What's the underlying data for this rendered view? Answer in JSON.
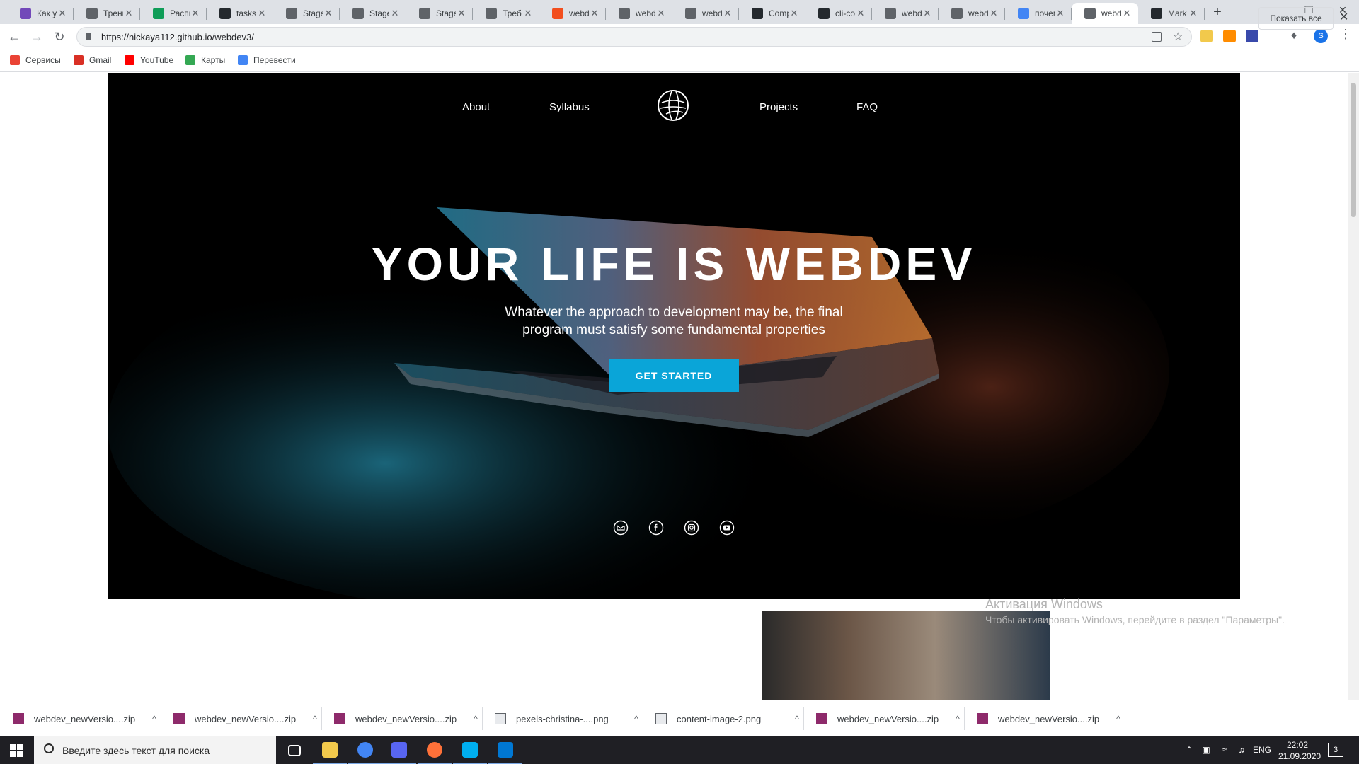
{
  "browser": {
    "tabs": [
      {
        "title": "Как у",
        "icon": "form-icon",
        "color": "#7248b9"
      },
      {
        "title": "Трени",
        "icon": "cap-icon",
        "color": "#5f6368"
      },
      {
        "title": "Распи",
        "icon": "sheets-icon",
        "color": "#0f9d58"
      },
      {
        "title": "tasks/",
        "icon": "github-icon",
        "color": "#24292e"
      },
      {
        "title": "Stage",
        "icon": "globe-icon",
        "color": "#5f6368"
      },
      {
        "title": "Stage",
        "icon": "globe-icon",
        "color": "#5f6368"
      },
      {
        "title": "Stage",
        "icon": "globe-icon",
        "color": "#5f6368"
      },
      {
        "title": "Требо",
        "icon": "globe-icon",
        "color": "#5f6368"
      },
      {
        "title": "webd",
        "icon": "figma-icon",
        "color": "#f24e1e"
      },
      {
        "title": "webd",
        "icon": "globe-icon",
        "color": "#5f6368"
      },
      {
        "title": "webd",
        "icon": "globe-icon",
        "color": "#5f6368"
      },
      {
        "title": "Comp",
        "icon": "github-icon",
        "color": "#24292e"
      },
      {
        "title": "cli-co",
        "icon": "github-icon",
        "color": "#24292e"
      },
      {
        "title": "webd",
        "icon": "globe-icon",
        "color": "#5f6368"
      },
      {
        "title": "webd",
        "icon": "globe-icon",
        "color": "#5f6368"
      },
      {
        "title": "почем",
        "icon": "google-icon",
        "color": "#4285f4"
      },
      {
        "title": "webd",
        "icon": "globe-icon",
        "color": "#5f6368",
        "active": true
      },
      {
        "title": "Mark",
        "icon": "github-icon",
        "color": "#24292e"
      }
    ],
    "new_tab": "+",
    "window": {
      "minimize": "–",
      "restore": "❐",
      "close": "✕"
    },
    "url": "https://nickaya112.github.io/webdev3/",
    "bookmarks": [
      {
        "label": "Сервисы",
        "icon": "apps-icon",
        "color": "#ea4335"
      },
      {
        "label": "Gmail",
        "icon": "gmail-icon",
        "color": "#d93025"
      },
      {
        "label": "YouTube",
        "icon": "youtube-icon",
        "color": "#ff0000"
      },
      {
        "label": "Карты",
        "icon": "maps-icon",
        "color": "#34a853"
      },
      {
        "label": "Перевести",
        "icon": "translate-icon",
        "color": "#4285f4"
      }
    ],
    "profile_initial": "S"
  },
  "page": {
    "nav": [
      {
        "label": "About",
        "active": true
      },
      {
        "label": "Syllabus"
      },
      {
        "label": "Projects"
      },
      {
        "label": "FAQ"
      }
    ],
    "hero": {
      "title": "YOUR LIFE IS WEBDEV",
      "subtitle_line1": "Whatever the approach to development may be, the final",
      "subtitle_line2": "program must satisfy some fundamental properties",
      "cta": "GET STARTED",
      "accent": "#0aa5d8"
    },
    "social": [
      "mail-icon",
      "facebook-icon",
      "instagram-icon",
      "youtube-icon"
    ],
    "watermark": {
      "line1": "Активация Windows",
      "line2": "Чтобы активировать Windows, перейдите в раздел \"Параметры\"."
    }
  },
  "downloads": {
    "items": [
      {
        "name": "webdev_newVersio....zip",
        "icon": "winrar-icon"
      },
      {
        "name": "webdev_newVersio....zip",
        "icon": "winrar-icon"
      },
      {
        "name": "webdev_newVersio....zip",
        "icon": "winrar-icon"
      },
      {
        "name": "pexels-christina-....png",
        "icon": "image-file-icon"
      },
      {
        "name": "content-image-2.png",
        "icon": "image-file-icon"
      },
      {
        "name": "webdev_newVersio....zip",
        "icon": "winrar-icon"
      },
      {
        "name": "webdev_newVersio....zip",
        "icon": "winrar-icon"
      }
    ],
    "show_all": "Показать все",
    "close": "✕"
  },
  "taskbar": {
    "search_placeholder": "Введите здесь текст для поиска",
    "apps": [
      {
        "name": "task-view-icon",
        "color": "#1f1f24"
      },
      {
        "name": "file-explorer-icon",
        "color": "#f2c94c"
      },
      {
        "name": "chrome-icon",
        "color": "#4285f4"
      },
      {
        "name": "discord-icon",
        "color": "#5865f2"
      },
      {
        "name": "firefox-icon",
        "color": "#ff7139"
      },
      {
        "name": "skype-icon",
        "color": "#00aff0"
      },
      {
        "name": "vscode-icon",
        "color": "#0078d4"
      }
    ],
    "language": "ENG",
    "time": "22:02",
    "date": "21.09.2020",
    "notifications": "3"
  }
}
